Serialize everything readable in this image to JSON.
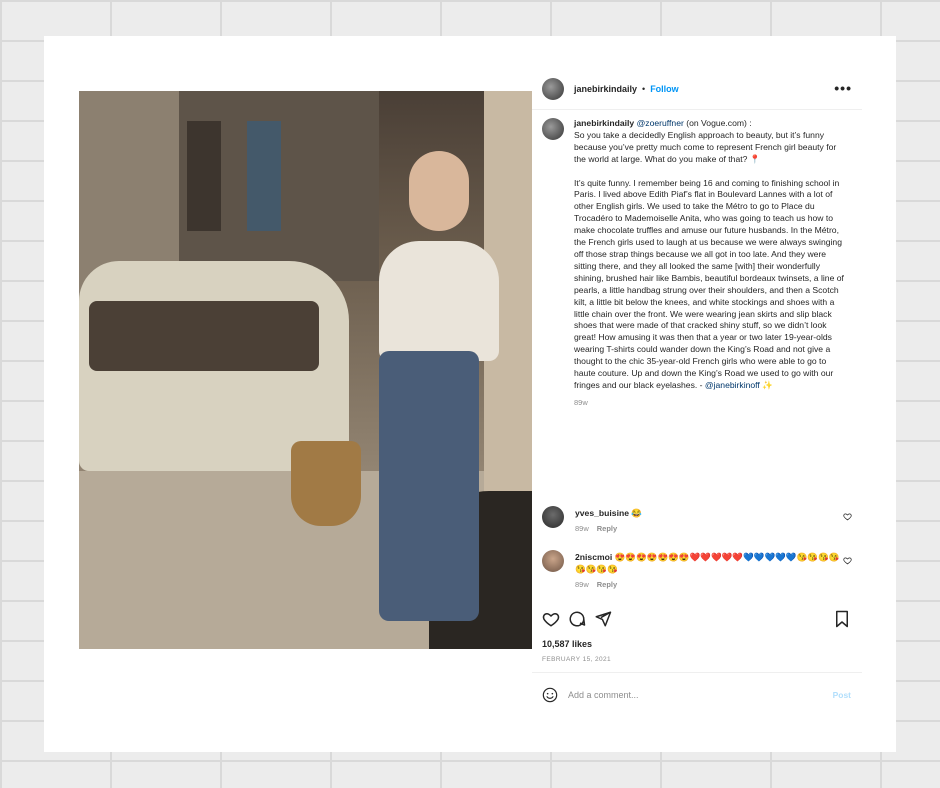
{
  "post": {
    "username": "janebirkindaily",
    "separator": "•",
    "follow_label": "Follow",
    "more_icon": "•••",
    "caption": {
      "username": "janebirkindaily",
      "mention": "@zoeruffner",
      "intro": " (on Vogue.com) :\nSo you take a decidedly English approach to beauty, but it’s funny because you’ve pretty much come to represent French girl beauty for the world at large. What do you make of that? 📍\n\nIt’s quite funny. I remember being 16 and coming to finishing school in Paris. I lived above Edith Piaf’s flat in Boulevard Lannes with a lot of other English girls. We used to take the Métro to go to Place du Trocadéro to Mademoiselle Anita, who was going to teach us how to make chocolate truffles and amuse our future husbands. In the Métro, the French girls used to laugh at us because we were always swinging off those strap things because we all got in too late. And they were sitting there, and they all looked the same [with] their wonderfully shining, brushed hair like Bambis, beautiful bordeaux twinsets, a line of pearls, a little handbag strung over their shoulders, and then a Scotch kilt, a little bit below the knees, and white stockings and shoes with a little chain over the front. We were wearing jean skirts and slip black shoes that were made of that cracked shiny stuff, so we didn’t look great! How amusing it was then that a year or two later 19-year-olds wearing T-shirts could wander down the King’s Road and not give a thought to the chic 35-year-old French girls who were able to go to haute couture. Up and down the King’s Road we used to go with our fringes and our black eyelashes. - ",
      "tail_mention": "@janebirkinoff",
      "tail_emoji": " ✨",
      "time": "89w"
    },
    "comments": [
      {
        "username": "yves_buisine",
        "text": " 😂",
        "time": "89w",
        "reply": "Reply"
      },
      {
        "username": "2niscmoi",
        "text": " 😍😍😍😍😍😍😍❤️❤️❤️❤️❤️💙💙💙💙💙😘😘😘😘😘😘😘😘",
        "time": "89w",
        "reply": "Reply"
      }
    ],
    "likes": "10,587 likes",
    "date": "FEBRUARY 15, 2021",
    "add_comment_placeholder": "Add a comment...",
    "post_label": "Post"
  }
}
